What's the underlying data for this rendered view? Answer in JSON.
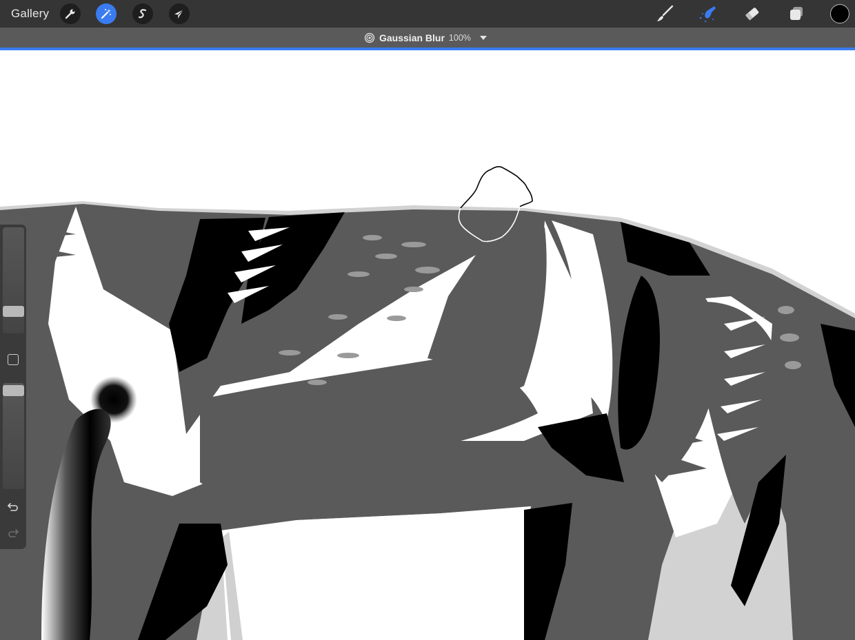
{
  "app": {
    "gallery_label": "Gallery"
  },
  "toolbar_left": [
    {
      "name": "actions",
      "icon": "wrench-icon"
    },
    {
      "name": "adjustments",
      "icon": "magic-wand-icon",
      "active": true
    },
    {
      "name": "selection",
      "icon": "selection-s-icon"
    },
    {
      "name": "transform",
      "icon": "cursor-arrow-icon"
    }
  ],
  "toolbar_right": [
    {
      "name": "brush",
      "icon": "brush-icon"
    },
    {
      "name": "smudge",
      "icon": "smudge-icon",
      "active": true
    },
    {
      "name": "eraser",
      "icon": "eraser-icon"
    },
    {
      "name": "layers",
      "icon": "layers-icon"
    },
    {
      "name": "color",
      "icon": "color-swatch",
      "value": "#000000"
    }
  ],
  "adjustment_bar": {
    "icon": "gaussian-blur-icon",
    "title": "Gaussian Blur",
    "percent": "100%",
    "dropdown_icon": "chevron-down-icon"
  },
  "sidebar": {
    "brush_size_level": 0.77,
    "opacity_level": 0.81,
    "modify_button_icon": "square-icon",
    "undo_icon": "undo-icon",
    "redo_icon": "redo-icon"
  },
  "colors": {
    "accent": "#3a7cf0",
    "toolbar_bg": "#353535",
    "subbar_bg": "#5a5a5a",
    "canvas_bg": "#ffffff"
  }
}
